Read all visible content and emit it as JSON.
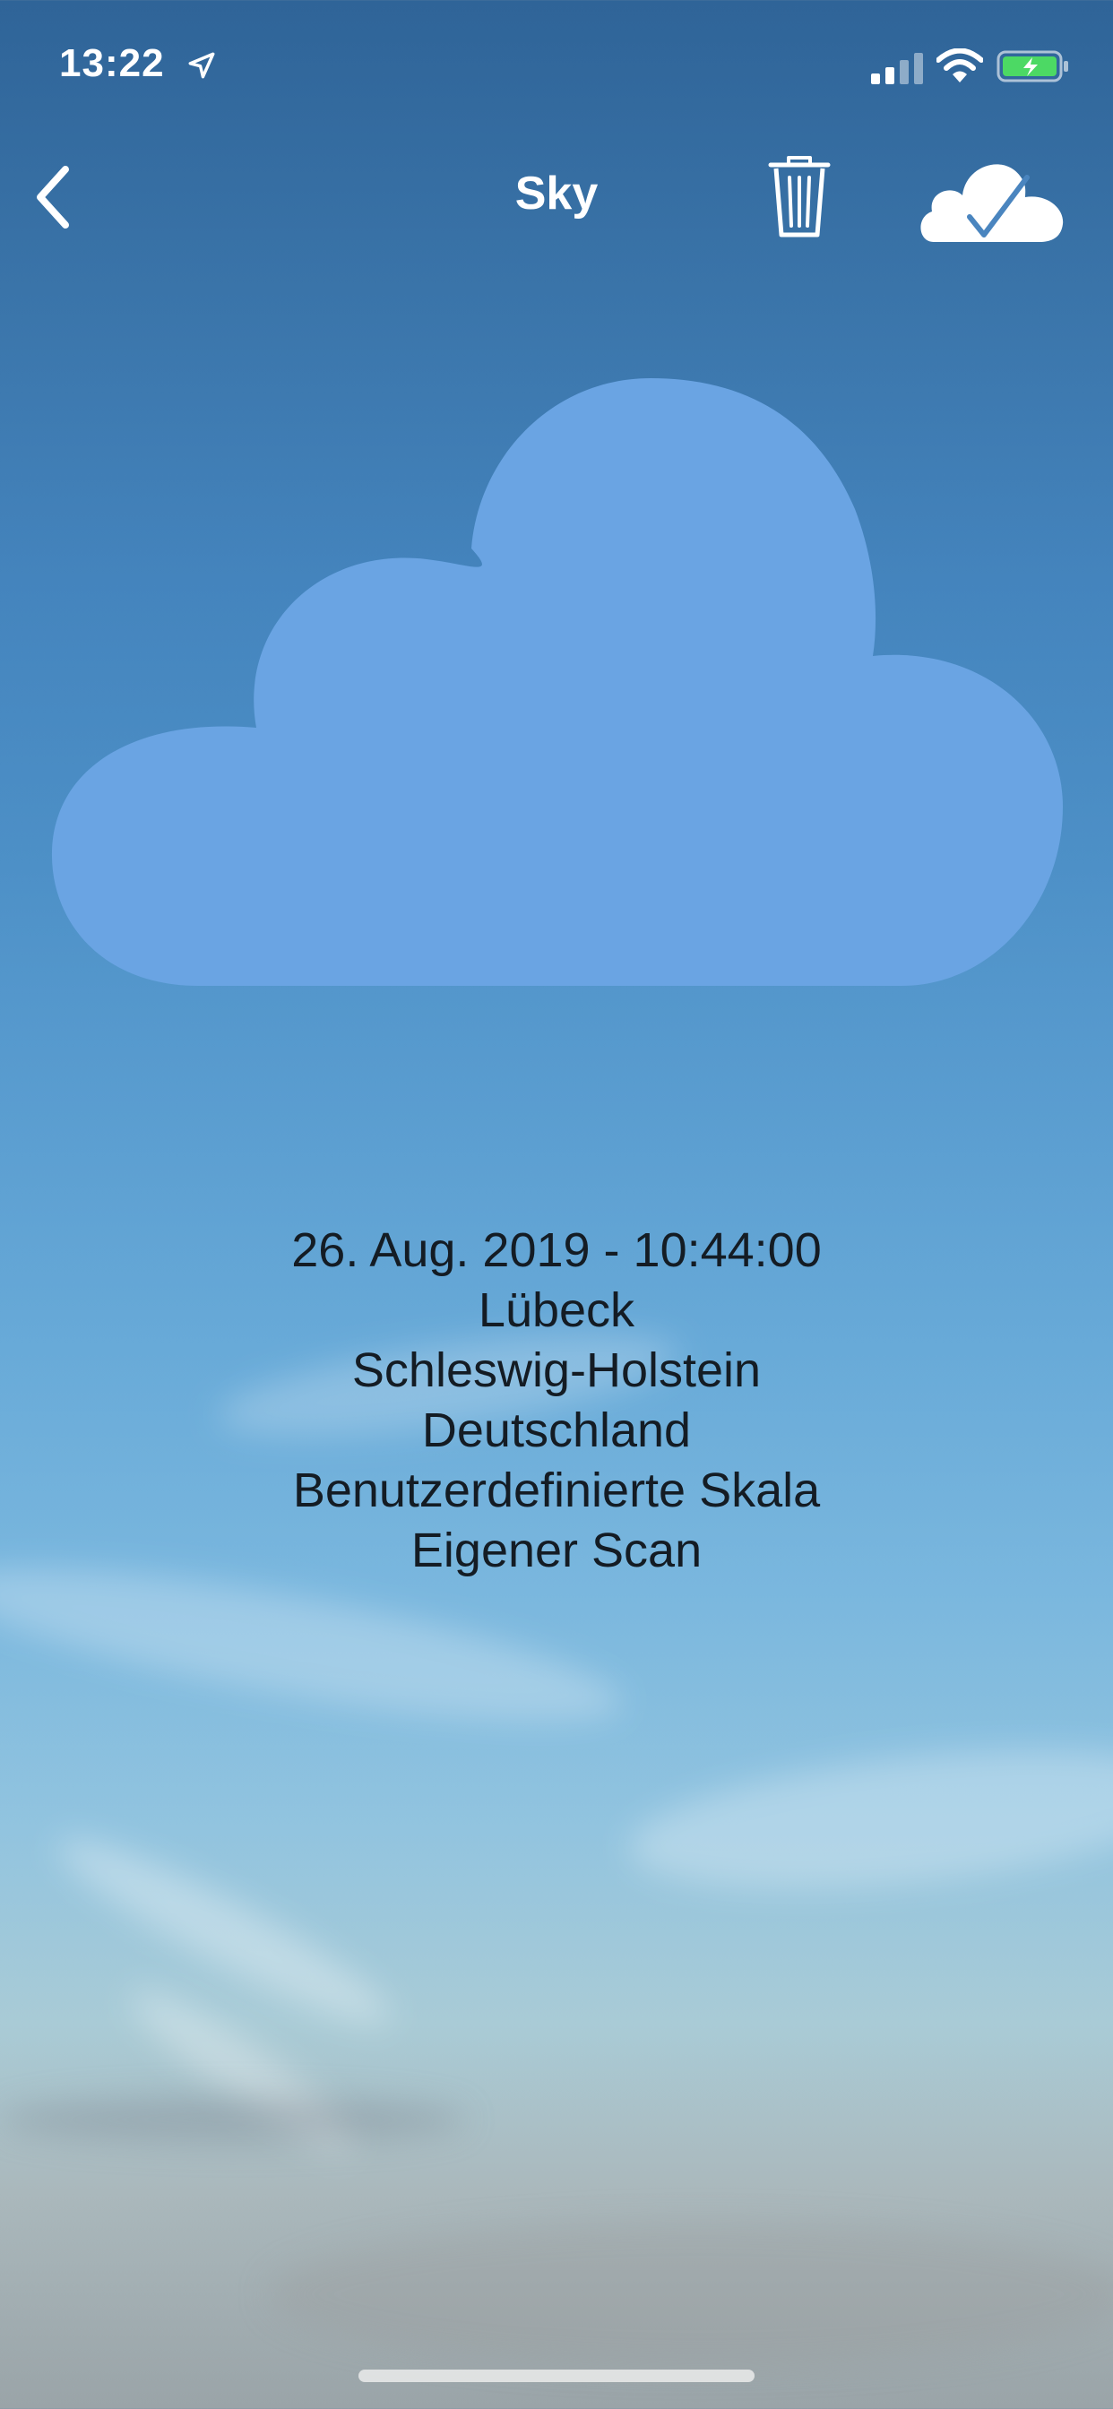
{
  "status_bar": {
    "time": "13:22",
    "location_icon": "location-arrow-icon",
    "signal_icon": "cellular-signal-icon",
    "wifi_icon": "wifi-icon",
    "battery_icon": "battery-charging-icon",
    "battery_color": "#4cd964"
  },
  "nav": {
    "title": "Sky",
    "back_icon": "chevron-left-icon",
    "delete_icon": "trash-icon",
    "upload_icon": "cloud-check-icon"
  },
  "main": {
    "cloud_icon": "cloud-icon",
    "cloud_color": "#6aa4e3",
    "details": [
      "26. Aug. 2019 - 10:44:00",
      "Lübeck",
      "Schleswig-Holstein",
      "Deutschland",
      "Benutzerdefinierte Skala",
      "Eigener Scan"
    ]
  }
}
